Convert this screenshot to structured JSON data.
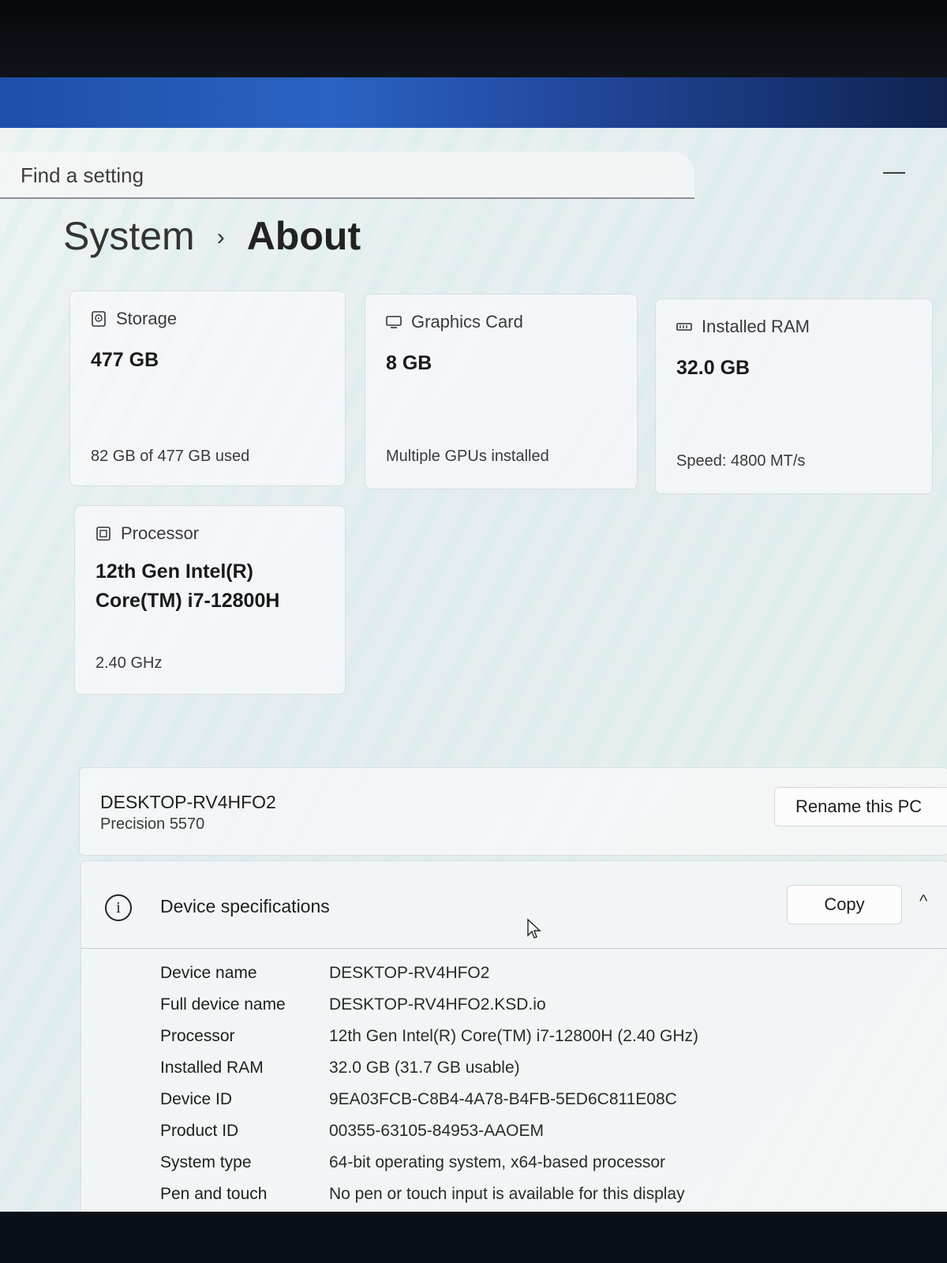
{
  "search": {
    "placeholder": "Find a setting"
  },
  "window_controls": {
    "minimize": "—"
  },
  "breadcrumb": {
    "parent": "System",
    "separator": "›",
    "current": "About"
  },
  "cards": {
    "storage": {
      "icon": "storage-icon",
      "title": "Storage",
      "value": "477 GB",
      "sub": "82 GB of 477 GB used"
    },
    "graphics": {
      "icon": "monitor-icon",
      "title": "Graphics Card",
      "value": "8 GB",
      "sub": "Multiple GPUs installed"
    },
    "ram": {
      "icon": "memory-icon",
      "title": "Installed RAM",
      "value": "32.0 GB",
      "sub": "Speed: 4800 MT/s"
    },
    "processor": {
      "icon": "processor-icon",
      "title": "Processor",
      "value_line1": "12th Gen Intel(R)",
      "value_line2": "Core(TM) i7-12800H",
      "sub": "2.40 GHz"
    }
  },
  "pc": {
    "name": "DESKTOP-RV4HFO2",
    "model": "Precision 5570",
    "rename_label": "Rename this PC"
  },
  "specs": {
    "title": "Device specifications",
    "copy_label": "Copy",
    "info_glyph": "i",
    "chevron": "^",
    "rows": [
      {
        "key": "Device name",
        "value": "DESKTOP-RV4HFO2"
      },
      {
        "key": "Full device name",
        "value": "DESKTOP-RV4HFO2.KSD.io"
      },
      {
        "key": "Processor",
        "value": "12th Gen Intel(R) Core(TM) i7-12800H (2.40 GHz)"
      },
      {
        "key": "Installed RAM",
        "value": "32.0 GB (31.7 GB usable)"
      },
      {
        "key": "Device ID",
        "value": "9EA03FCB-C8B4-4A78-B4FB-5ED6C811E08C"
      },
      {
        "key": "Product ID",
        "value": "00355-63105-84953-AAOEM"
      },
      {
        "key": "System type",
        "value": "64-bit operating system, x64-based processor"
      },
      {
        "key": "Pen and touch",
        "value": "No pen or touch input is available for this display"
      }
    ]
  }
}
